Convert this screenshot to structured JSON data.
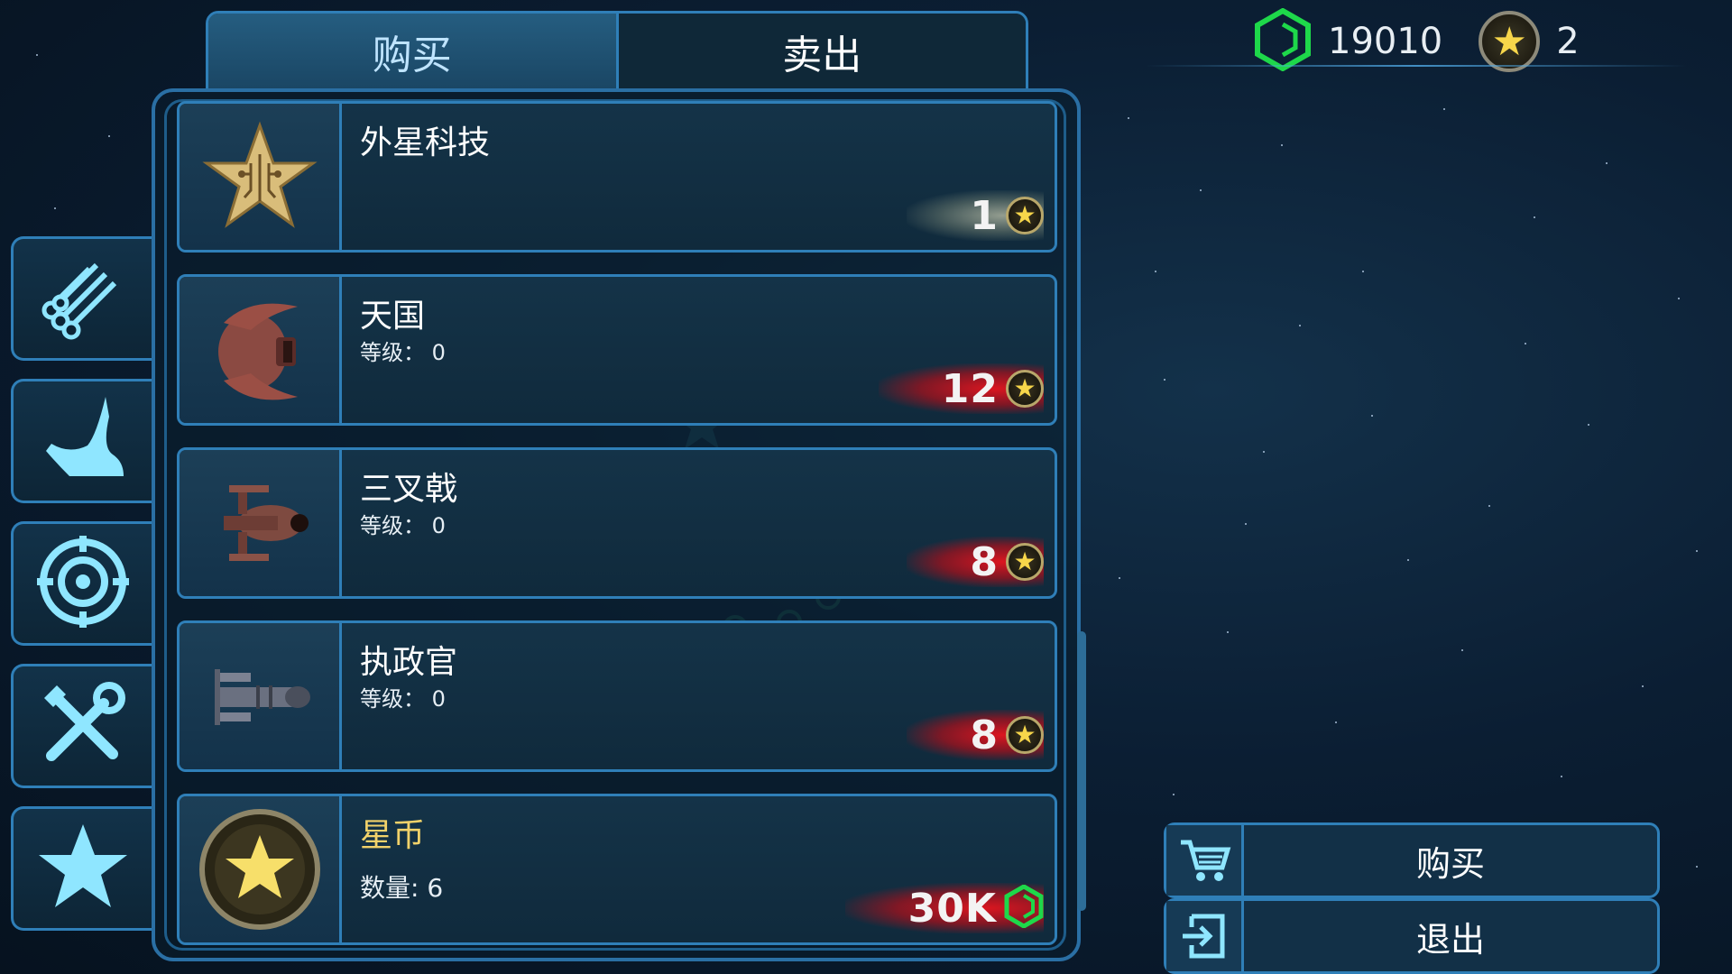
{
  "tabs": {
    "buy": "购买",
    "sell": "卖出"
  },
  "currency": {
    "cubes": "19010",
    "stars": "2"
  },
  "items": [
    {
      "name": "外星科技",
      "sub": "",
      "price": "1",
      "price_currency": "star-icon",
      "glow": "pale"
    },
    {
      "name": "天国",
      "sub": "等级： 0",
      "price": "12",
      "price_currency": "star-icon",
      "glow": "red"
    },
    {
      "name": "三叉戟",
      "sub": "等级： 0",
      "price": "8",
      "price_currency": "star-icon",
      "glow": "red"
    },
    {
      "name": "执政官",
      "sub": "等级： 0",
      "price": "8",
      "price_currency": "star-icon",
      "glow": "red"
    },
    {
      "name": "星币",
      "sub": "数量: 6",
      "price": "30K",
      "price_currency": "green-cube-icon",
      "glow": "red"
    }
  ],
  "sidenav": [
    "materials-icon",
    "hook-icon",
    "target-icon",
    "tools-icon",
    "star-icon"
  ],
  "actions": {
    "buy": "购买",
    "exit": "退出"
  },
  "colors": {
    "accent": "#2f7fb8",
    "gold": "#f2d26a",
    "green_cube": "#1ed84a",
    "price_glow": "#e6141e"
  }
}
